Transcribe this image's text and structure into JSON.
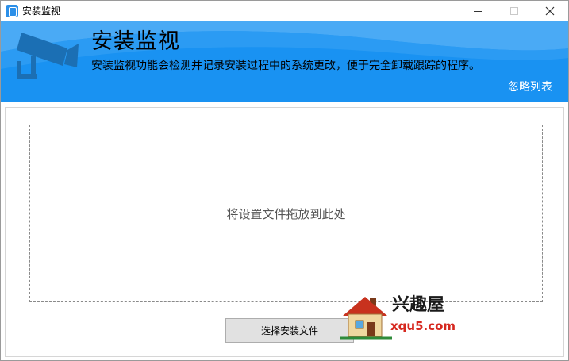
{
  "window": {
    "title": "安装监视"
  },
  "banner": {
    "title": "安装监视",
    "description": "安装监视功能会检测并记录安装过程中的系统更改，便于完全卸载跟踪的程序。",
    "ignore_list_link": "忽略列表"
  },
  "main": {
    "drop_hint": "将设置文件拖放到此处",
    "select_button_label": "选择安装文件"
  },
  "watermark": {
    "site_name": "兴趣屋",
    "site_url": "xqu5.com"
  },
  "icons": [
    "app-icon",
    "minimize-icon",
    "maximize-icon",
    "close-icon",
    "camera-icon",
    "house-logo-icon"
  ],
  "colors": {
    "banner": "#1992f2",
    "banner_light": "#4aaaf5",
    "watermark_url": "#d6281f"
  }
}
